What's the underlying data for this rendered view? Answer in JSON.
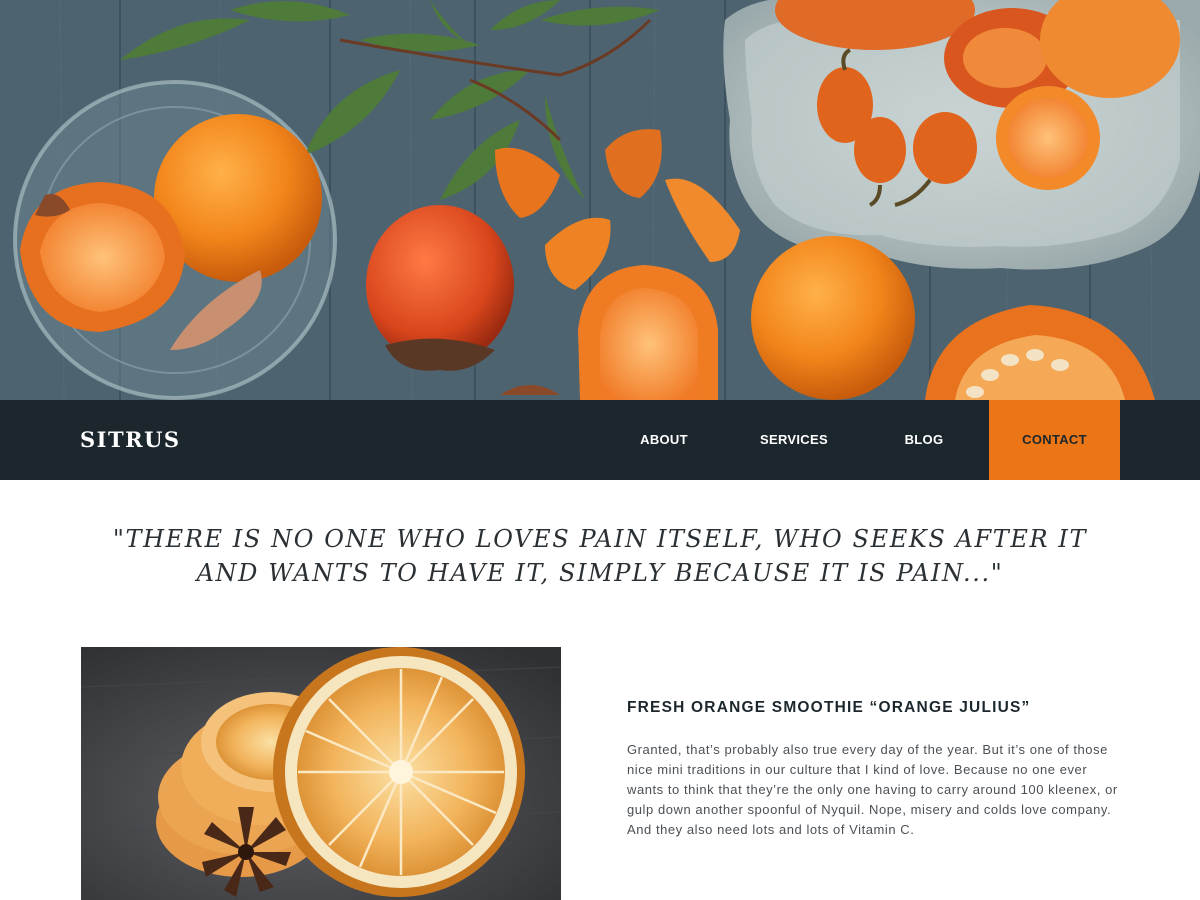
{
  "brand": {
    "name": "SITRUS",
    "accent_color": "#ec7616",
    "nav_background": "#1c272d"
  },
  "nav": {
    "items": [
      {
        "label": "ABOUT"
      },
      {
        "label": "SERVICES"
      },
      {
        "label": "BLOG"
      },
      {
        "label": "CONTACT",
        "active": true
      }
    ]
  },
  "hero": {
    "image": "hero-photo-persimmons-oranges-peppers-on-wooden-table"
  },
  "quote": {
    "line1": "\"THERE IS NO ONE WHO LOVES PAIN ITSELF, WHO SEEKS AFTER IT",
    "line2": "AND WANTS TO HAVE IT, SIMPLY BECAUSE IT IS PAIN...\""
  },
  "article": {
    "image": "dried-orange-slices-with-star-anise-photo",
    "title": "FRESH ORANGE SMOOTHIE “ORANGE JULIUS”",
    "body": "Granted, that’s probably also true every day of the year. But it’s one of those nice mini traditions in our culture that I kind of love. Because no one ever wants to think that they’re the only one having to carry around 100 kleenex, or gulp down another spoonful of Nyquil.  Nope, misery and colds love company.  And they also need lots and lots of Vitamin C."
  }
}
